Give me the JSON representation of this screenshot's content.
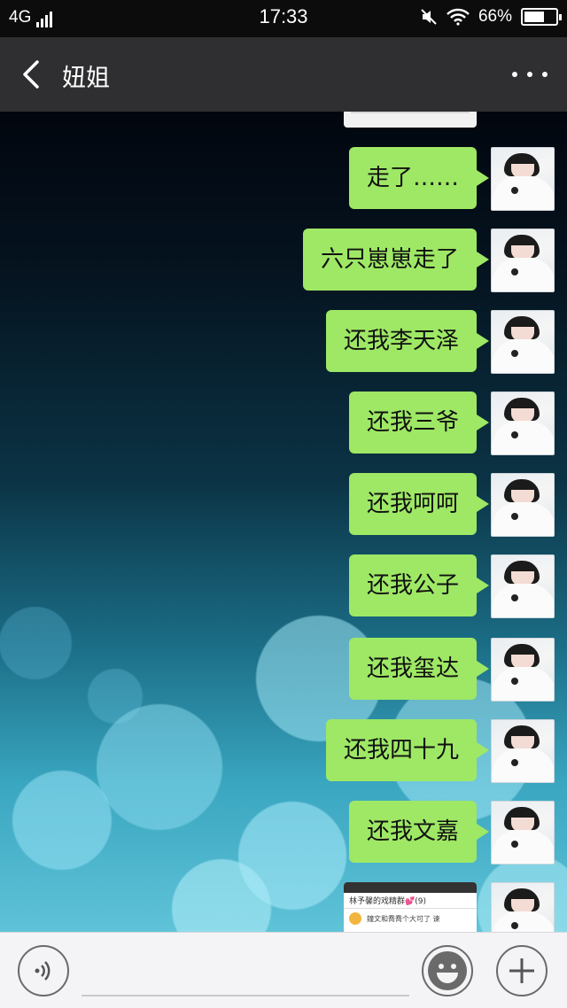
{
  "status_bar": {
    "network": "4G",
    "time": "17:33",
    "battery_percent_text": "66%",
    "battery_level": 0.66
  },
  "header": {
    "title": "妞姐",
    "back_icon": "chevron-left-icon",
    "more_icon": "more-dots-icon"
  },
  "messages": [
    {
      "text": "走了……"
    },
    {
      "text": "六只崽崽走了"
    },
    {
      "text": "还我李天泽"
    },
    {
      "text": "还我三爷"
    },
    {
      "text": "还我呵呵"
    },
    {
      "text": "还我公子"
    },
    {
      "text": "还我玺达"
    },
    {
      "text": "还我四十九"
    },
    {
      "text": "还我文嘉"
    }
  ],
  "image_message": {
    "group_title": "林予馨的戏精群💕(9)",
    "preview_text": "鐘文和喬喬个大可了 谏"
  },
  "input_bar": {
    "voice_icon": "voice-icon",
    "emoji_icon": "emoji-icon",
    "plus_icon": "plus-icon"
  },
  "colors": {
    "bubble": "#9ee865",
    "header_bg": "#2f2f31"
  }
}
